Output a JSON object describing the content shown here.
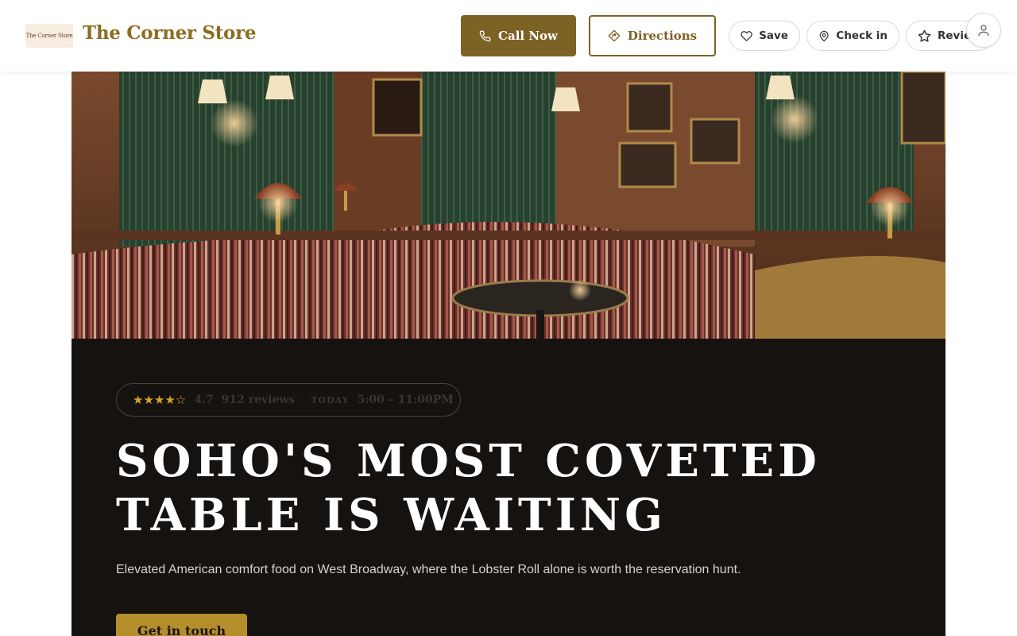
{
  "header": {
    "logo_text": "The Corner Store",
    "brand_name": "The Corner Store",
    "call_label": "Call Now",
    "directions_label": "Directions",
    "save_label": "Save",
    "checkin_label": "Check in",
    "review_label": "Review"
  },
  "hero": {
    "stars": "★★★★☆",
    "rating": "4.7",
    "review_count": "912 reviews",
    "today_label": "Today",
    "hours": "5:00 – 11:00PM",
    "headline_line1": "Soho's most coveted",
    "headline_line2": "table is waiting",
    "subheadline": "Elevated American comfort food on West Broadway, where the Lobster Roll alone is worth the reservation hunt.",
    "cta_label": "Get in touch"
  },
  "colors": {
    "accent": "#7d6225",
    "brand_text": "#8c6d1f",
    "cta": "#b58e2c",
    "dark_bg": "#151210",
    "star": "#d4a52a"
  },
  "icons": {
    "call": "phone-icon",
    "directions": "directions-icon",
    "save": "heart-icon",
    "checkin": "map-pin-icon",
    "review": "star-icon",
    "account": "user-icon"
  }
}
